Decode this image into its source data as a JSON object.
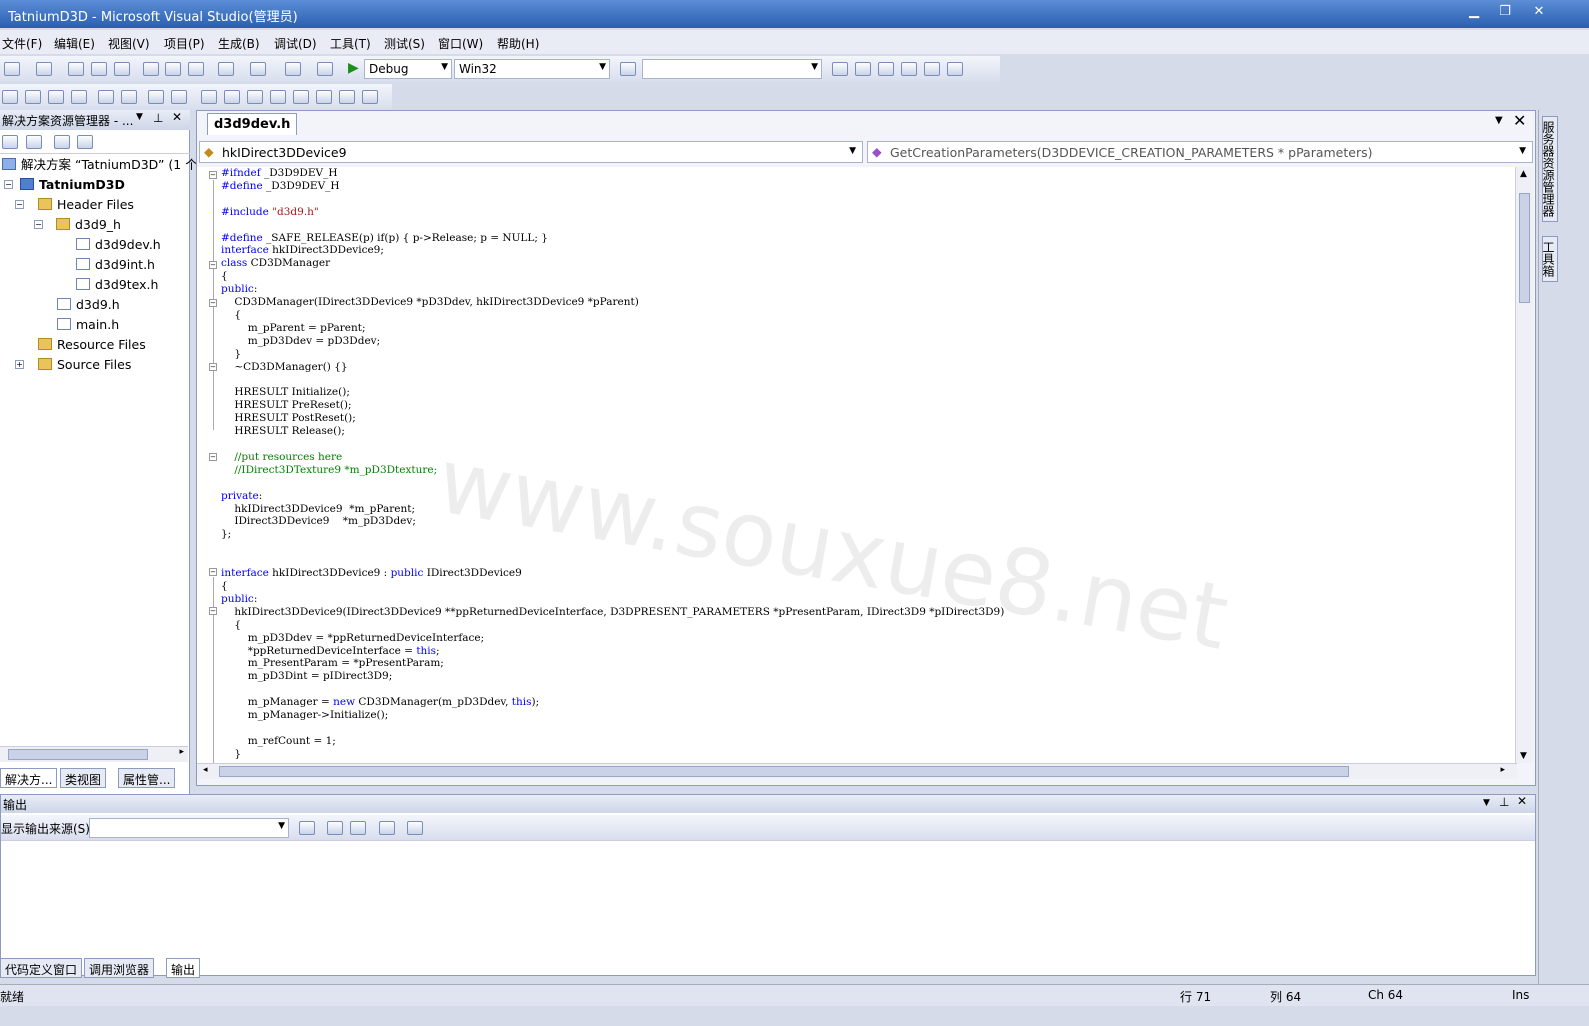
{
  "window": {
    "title": "TatniumD3D - Microsoft Visual Studio(管理员)"
  },
  "menu": [
    "文件(F)",
    "编辑(E)",
    "视图(V)",
    "项目(P)",
    "生成(B)",
    "调试(D)",
    "工具(T)",
    "测试(S)",
    "窗口(W)",
    "帮助(H)"
  ],
  "toolbar": {
    "config": "Debug",
    "platform": "Win32"
  },
  "solution_explorer": {
    "header": "解决方案资源管理器 - ...",
    "tree": [
      "解决方案 “TatniumD3D” (1 个",
      "TatniumD3D",
      "Header Files",
      "d3d9_h",
      "d3d9dev.h",
      "d3d9int.h",
      "d3d9tex.h",
      "d3d9.h",
      "main.h",
      "Resource Files",
      "Source Files"
    ],
    "tabs": [
      "解决方...",
      "类视图",
      "属性管..."
    ]
  },
  "editor": {
    "tab": "d3d9dev.h",
    "nav_left": "hkIDirect3DDevice9",
    "nav_right": "GetCreationParameters(D3DDEVICE_CREATION_PARAMETERS * pParameters)"
  },
  "output": {
    "header": "输出",
    "source_label": "显示输出来源(S):",
    "tabs": [
      "代码定义窗口",
      "调用浏览器",
      "输出"
    ]
  },
  "status": {
    "text": "就绪",
    "line": "行 71",
    "col": "列 64",
    "ch": "Ch 64",
    "mode": "Ins"
  },
  "right_strip": [
    "服务器资源管理器",
    "工具箱"
  ],
  "watermark": "www.souxue8.net"
}
